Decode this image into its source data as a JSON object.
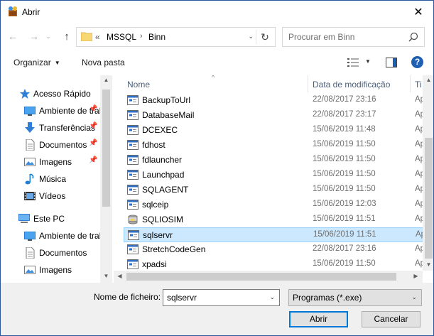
{
  "window": {
    "title": "Abrir",
    "close_glyph": "✕"
  },
  "nav": {
    "back_glyph": "←",
    "forward_glyph": "→",
    "recent_glyph": "⌄",
    "up_glyph": "↑",
    "path_overflow": "«",
    "path": [
      "MSSQL",
      "Binn"
    ],
    "path_separator": "›",
    "dropdown_glyph": "⌄",
    "refresh_glyph": "↻",
    "search_placeholder": "Procurar em Binn"
  },
  "toolbar": {
    "organize_label": "Organizar",
    "organize_caret": "▼",
    "new_folder_label": "Nova pasta",
    "view_caret": "▼",
    "help_label": "?"
  },
  "sidebar": {
    "pin_glyph": "📌",
    "items": [
      {
        "label": "Acesso Rápido",
        "icon": "star-icon",
        "pinned": false
      },
      {
        "label": "Ambiente de trabalho",
        "icon": "desktop-icon",
        "pinned": true
      },
      {
        "label": "Transferências",
        "icon": "download-icon",
        "pinned": true
      },
      {
        "label": "Documentos",
        "icon": "document-icon",
        "pinned": true
      },
      {
        "label": "Imagens",
        "icon": "image-icon",
        "pinned": true
      },
      {
        "label": "Música",
        "icon": "music-icon",
        "pinned": false
      },
      {
        "label": "Vídeos",
        "icon": "video-icon",
        "pinned": false
      },
      {
        "label": "Este PC",
        "icon": "computer-icon",
        "pinned": false
      },
      {
        "label": "Ambiente de trabalho",
        "icon": "desktop-icon",
        "pinned": false
      },
      {
        "label": "Documentos",
        "icon": "document-icon",
        "pinned": false
      },
      {
        "label": "Imagens",
        "icon": "image-icon",
        "pinned": false
      }
    ]
  },
  "columns": {
    "name": "Nome",
    "modified": "Data de modificação",
    "type": "Ti",
    "sort_glyph": "^"
  },
  "files": [
    {
      "name": "BackupToUrl",
      "modified": "22/08/2017 23:16",
      "type": "Ap",
      "icon": "exe-icon"
    },
    {
      "name": "DatabaseMail",
      "modified": "22/08/2017 23:17",
      "type": "Ap",
      "icon": "exe-icon"
    },
    {
      "name": "DCEXEC",
      "modified": "15/06/2019 11:48",
      "type": "Ap",
      "icon": "exe-icon"
    },
    {
      "name": "fdhost",
      "modified": "15/06/2019 11:50",
      "type": "Ap",
      "icon": "exe-icon"
    },
    {
      "name": "fdlauncher",
      "modified": "15/06/2019 11:50",
      "type": "Ap",
      "icon": "exe-icon"
    },
    {
      "name": "Launchpad",
      "modified": "15/06/2019 11:50",
      "type": "Ap",
      "icon": "exe-icon"
    },
    {
      "name": "SQLAGENT",
      "modified": "15/06/2019 11:50",
      "type": "Ap",
      "icon": "exe-icon"
    },
    {
      "name": "sqlceip",
      "modified": "15/06/2019 12:03",
      "type": "Ap",
      "icon": "exe-icon"
    },
    {
      "name": "SQLIOSIM",
      "modified": "15/06/2019 11:51",
      "type": "Ap",
      "icon": "sqliosim-icon"
    },
    {
      "name": "sqlservr",
      "modified": "15/06/2019 11:51",
      "type": "Ap",
      "icon": "exe-icon",
      "selected": true
    },
    {
      "name": "StretchCodeGen",
      "modified": "22/08/2017 23:16",
      "type": "Ap",
      "icon": "exe-icon"
    },
    {
      "name": "xpadsi",
      "modified": "15/06/2019 11:50",
      "type": "Ap",
      "icon": "exe-icon"
    }
  ],
  "scroll": {
    "up_glyph": "▲",
    "down_glyph": "▼",
    "left_glyph": "◀",
    "right_glyph": "▶"
  },
  "footer": {
    "filename_label": "Nome de ficheiro:",
    "filename_value": "sqlservr",
    "filename_dd_glyph": "⌄",
    "filetype_value": "Programas (*.exe)",
    "filetype_dd_glyph": "⌄",
    "open_label": "Abrir",
    "cancel_label": "Cancelar"
  },
  "colors": {
    "accent": "#0078d7",
    "selection": "#cce8ff",
    "selection_border": "#99d1ff",
    "folder": "#f8d775"
  }
}
